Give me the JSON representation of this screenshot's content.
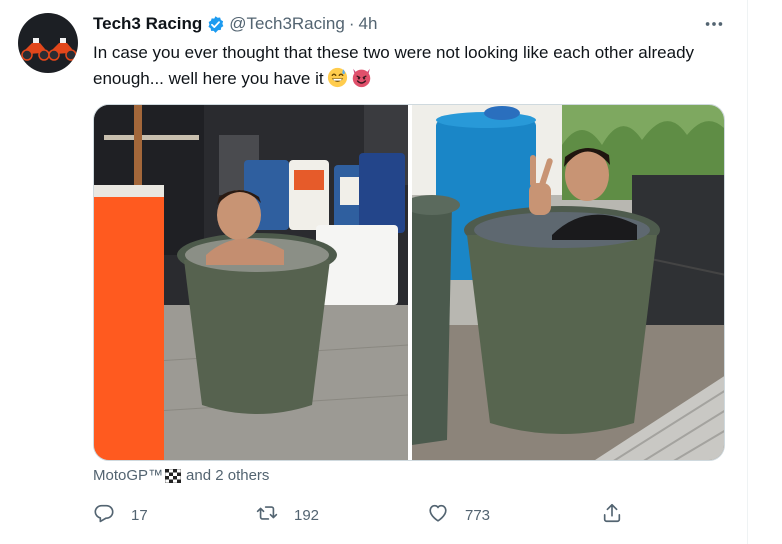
{
  "tweet": {
    "author": {
      "display_name": "Tech3 Racing",
      "handle": "@Tech3Racing",
      "verified": true,
      "avatar": "motorbikes-avatar"
    },
    "separator": "·",
    "timestamp": "4h",
    "text": "In case you ever thought that these two were not looking like each other already enough... well here you have it",
    "emojis": [
      "grinning-sweat-emoji",
      "smiling-devil-emoji"
    ],
    "media": [
      {
        "description": "rider-in-ice-bucket-garage"
      },
      {
        "description": "rider-in-ice-bucket-outdoor"
      }
    ],
    "tagged": {
      "first": "MotoGP™",
      "flag_icon": "checkered-flag-icon",
      "rest": "and 2 others"
    },
    "actions": {
      "reply": {
        "icon": "reply-icon",
        "count": "17"
      },
      "retweet": {
        "icon": "retweet-icon",
        "count": "192"
      },
      "like": {
        "icon": "heart-icon",
        "count": "773"
      },
      "share": {
        "icon": "share-icon"
      }
    },
    "more_icon": "more-dots-icon"
  },
  "colors": {
    "text": "#0f1419",
    "secondary": "#536471",
    "verified": "#1d9bf0",
    "border": "#cfd9de"
  }
}
